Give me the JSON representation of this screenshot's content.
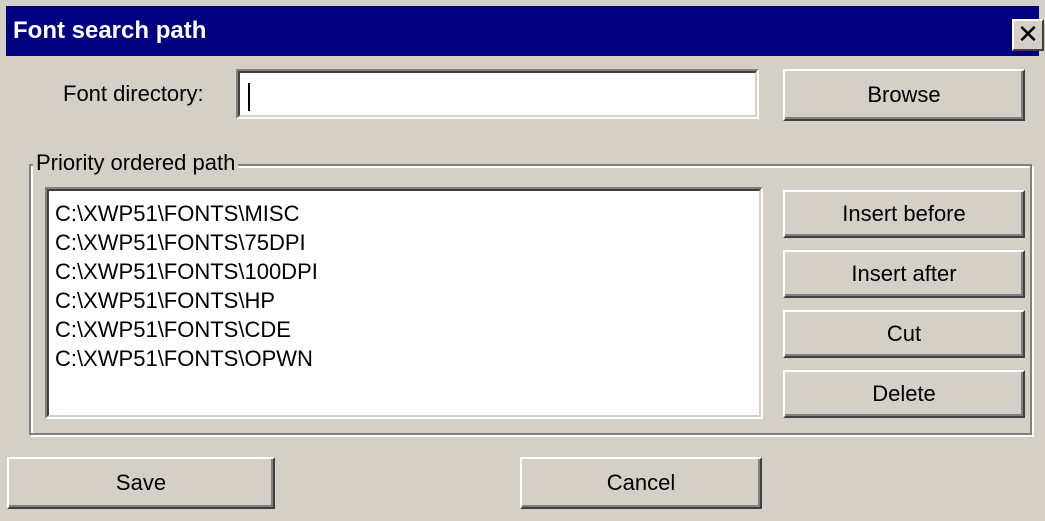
{
  "window": {
    "title": "Font search path",
    "close_glyph": "✕",
    "close_icon": "close-icon"
  },
  "font_directory": {
    "label": "Font directory:",
    "value": "",
    "browse_label": "Browse"
  },
  "priority_path": {
    "legend": "Priority ordered path",
    "items": [
      "C:\\XWP51\\FONTS\\MISC",
      "C:\\XWP51\\FONTS\\75DPI",
      "C:\\XWP51\\FONTS\\100DPI",
      "C:\\XWP51\\FONTS\\HP",
      "C:\\XWP51\\FONTS\\CDE",
      "C:\\XWP51\\FONTS\\OPWN"
    ],
    "actions": {
      "insert_before": "Insert before",
      "insert_after": "Insert after",
      "cut": "Cut",
      "delete": "Delete"
    }
  },
  "footer": {
    "save_label": "Save",
    "cancel_label": "Cancel"
  },
  "colors": {
    "title_bar": "#000080",
    "face": "#d4d0c8",
    "field": "#ffffff"
  }
}
